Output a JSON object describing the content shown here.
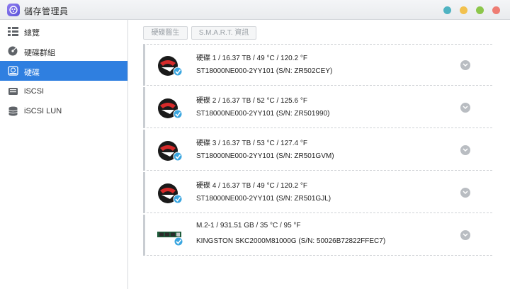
{
  "app": {
    "title": "儲存管理員",
    "window_buttons": [
      {
        "name": "help",
        "color": "#4fb3c2"
      },
      {
        "name": "minimize",
        "color": "#f2c14e"
      },
      {
        "name": "maximize",
        "color": "#8cc64b"
      },
      {
        "name": "close",
        "color": "#ee7c73"
      }
    ]
  },
  "sidebar": {
    "items": [
      {
        "label": "總覽",
        "icon": "overview-icon",
        "active": false
      },
      {
        "label": "硬碟群組",
        "icon": "disk-group-icon",
        "active": false
      },
      {
        "label": "硬碟",
        "icon": "disk-icon",
        "active": true
      },
      {
        "label": "iSCSI",
        "icon": "iscsi-icon",
        "active": false
      },
      {
        "label": "iSCSI LUN",
        "icon": "iscsi-lun-icon",
        "active": false
      }
    ]
  },
  "toolbar": {
    "health_label": "硬碟醫生",
    "smart_label": "S.M.A.R.T. 資訊"
  },
  "disks": [
    {
      "summary": "硬碟 1 / 16.37 TB / 49 °C / 120.2 °F",
      "model": "ST18000NE000-2YY101 (S/N: ZR502CEY)",
      "icon": "hdd-icon"
    },
    {
      "summary": "硬碟 2 / 16.37 TB / 52 °C / 125.6 °F",
      "model": "ST18000NE000-2YY101 (S/N: ZR501990)",
      "icon": "hdd-icon"
    },
    {
      "summary": "硬碟 3 / 16.37 TB / 53 °C / 127.4 °F",
      "model": "ST18000NE000-2YY101 (S/N: ZR501GVM)",
      "icon": "hdd-icon"
    },
    {
      "summary": "硬碟 4 / 16.37 TB / 49 °C / 120.2 °F",
      "model": "ST18000NE000-2YY101 (S/N: ZR501GJL)",
      "icon": "hdd-icon"
    },
    {
      "summary": "M.2-1 / 931.51 GB / 35 °C / 95 °F",
      "model": "KINGSTON SKC2000M81000G (S/N: 50026B72822FFEC7)",
      "icon": "ssd-m2-icon"
    }
  ],
  "colors": {
    "accent": "#2f7fe0",
    "status_ok": "#3aa6e0"
  }
}
